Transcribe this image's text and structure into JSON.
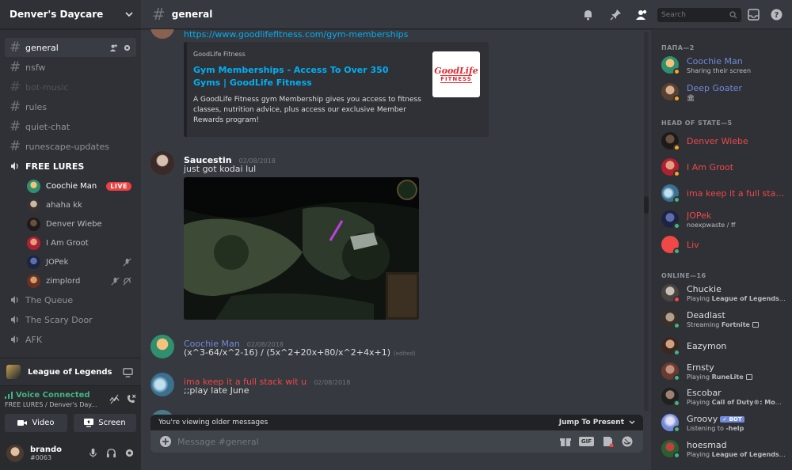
{
  "server": {
    "name": "Denver's Daycare"
  },
  "channels": [
    {
      "name": "general",
      "state": "active"
    },
    {
      "name": "nsfw",
      "state": "normal"
    },
    {
      "name": "bot-music",
      "state": "muted"
    },
    {
      "name": "rules",
      "state": "normal"
    },
    {
      "name": "quiet-chat",
      "state": "normal"
    },
    {
      "name": "runescape-updates",
      "state": "normal"
    }
  ],
  "voice_channel": {
    "name": "FREE LURES",
    "users": [
      {
        "name": "Coochie Man",
        "badge": "LIVE"
      },
      {
        "name": "ahaha kk"
      },
      {
        "name": "Denver Wiebe"
      },
      {
        "name": "I Am Groot"
      },
      {
        "name": "JOPek"
      },
      {
        "name": "zimplord"
      }
    ]
  },
  "other_voice": [
    "The Queue",
    "The Scary Door",
    "AFK"
  ],
  "game_activity": {
    "name": "League of Legends"
  },
  "voice_status": {
    "title": "Voice Connected",
    "subtitle": "FREE LURES / Denver's Day...",
    "video_label": "Video",
    "screen_label": "Screen"
  },
  "user": {
    "name": "brando",
    "tag": "#0063"
  },
  "header": {
    "channel": "general",
    "search_placeholder": "Search"
  },
  "messages": {
    "link": "https://www.goodlifefitness.com/gym-memberships",
    "embed": {
      "provider": "GoodLife Fitness",
      "title": "Gym Memberships - Access To Over 350 Gyms | GoodLife Fitness",
      "description": "A GoodLife Fitness gym Membership gives you access to fitness classes, nutrition advice, plus access our exclusive Member Rewards program!",
      "thumb_line1": "GoodLife",
      "thumb_line2": "FITNESS"
    },
    "m1": {
      "author": "Saucestin",
      "date": "02/08/2018",
      "text": "just got kodai lul"
    },
    "m2": {
      "author": "Coochie Man",
      "date": "02/08/2018",
      "text": "(x^3-64/x^2-16) / (5x^2+20x+80/x^2+4x+1)",
      "edited": "(edited)"
    },
    "m3": {
      "author": "ima keep it a full stack wit u",
      "date": "02/08/2018",
      "text": ";;play late June"
    }
  },
  "composer": {
    "older_notice": "You're viewing older messages",
    "jump_label": "Jump To Present",
    "placeholder": "Message #general",
    "gif_label": "GIF"
  },
  "member_groups": {
    "g1": "ПАПА—2",
    "g2": "HEAD OF STATE—5",
    "g3": "ONLINE—16"
  },
  "members": [
    {
      "name": "Coochie Man",
      "status": "Sharing their screen",
      "color": "#7289da"
    },
    {
      "name": "Deep Goater",
      "status": "🏛",
      "color": "#7289da"
    },
    {
      "name": "Denver Wiebe",
      "status": "",
      "color": "#f04747"
    },
    {
      "name": "I Am Groot",
      "status": "",
      "color": "#f04747"
    },
    {
      "name": "ima keep it a full stack wit u",
      "status": "",
      "color": "#f04747"
    },
    {
      "name": "JOPek",
      "status": "noexpwaste / ff",
      "color": "#f04747"
    },
    {
      "name": "Liv",
      "status": "",
      "color": "#f04747"
    },
    {
      "name": "Chuckie",
      "status_prefix": "Playing ",
      "status_game": "League of Legends",
      "color": "#dcddde"
    },
    {
      "name": "Deadlast",
      "status_prefix": "Streaming ",
      "status_game": "Fortnite",
      "color": "#dcddde"
    },
    {
      "name": "Eazymon",
      "status": "",
      "color": "#dcddde"
    },
    {
      "name": "Ernsty",
      "status_prefix": "Playing ",
      "status_game": "RuneLite",
      "color": "#dcddde"
    },
    {
      "name": "Escobar",
      "status_prefix": "Playing ",
      "status_game": "Call of Duty®: Mod...",
      "color": "#dcddde"
    },
    {
      "name": "Groovy",
      "badge": "✓ BOT",
      "status_prefix": "Listening to ",
      "status_game": "-help",
      "color": "#dcddde"
    },
    {
      "name": "hoesmad",
      "status_prefix": "Playing ",
      "status_game": "League of Legends",
      "color": "#dcddde"
    }
  ],
  "colors": {
    "online": "#43b581",
    "idle": "#faa61a",
    "dnd": "#f04747",
    "link": "#00b0f4",
    "accent": "#7289da"
  }
}
